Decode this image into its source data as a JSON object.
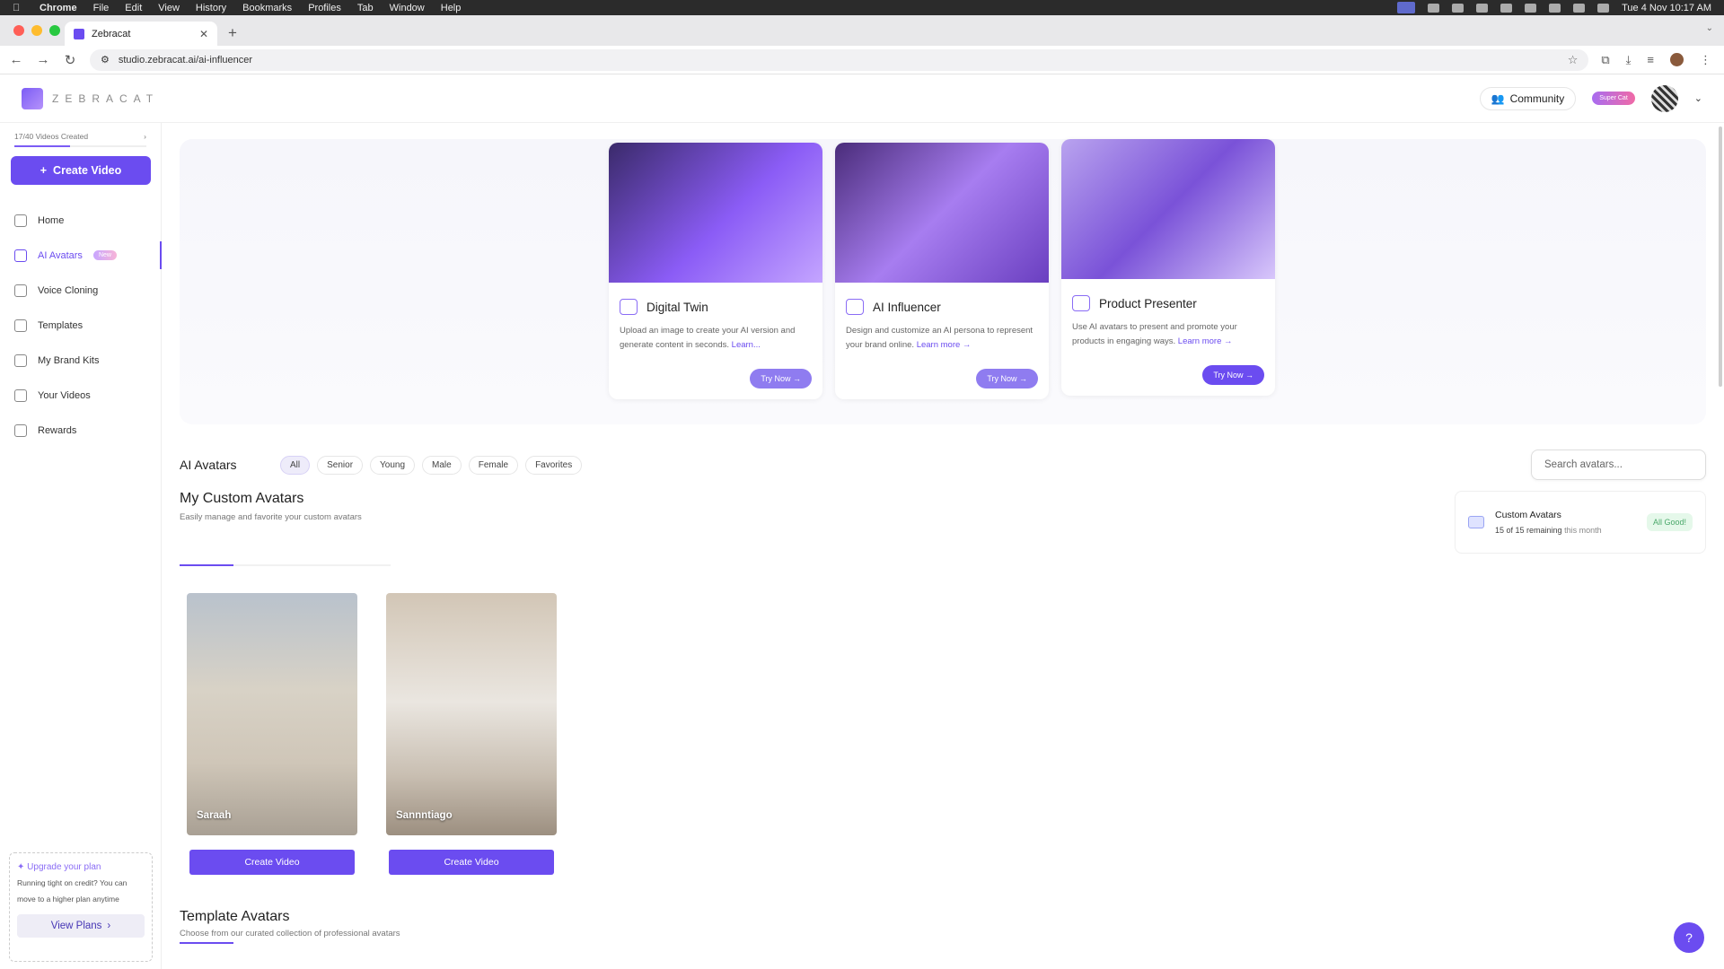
{
  "os_menu": {
    "app": "Chrome",
    "items": [
      "File",
      "Edit",
      "View",
      "History",
      "Bookmarks",
      "Profiles",
      "Tab",
      "Window",
      "Help"
    ],
    "clock": "Tue 4 Nov  10:17 AM"
  },
  "browser": {
    "tab_title": "Zebracat",
    "url": "studio.zebracat.ai/ai-influencer"
  },
  "header": {
    "logo_text": "ZEBRACAT",
    "community_label": "Community",
    "plan_label": "Super Cat"
  },
  "sidebar": {
    "usage_text": "17/40 Videos Created",
    "usage_fraction": 0.425,
    "create_label": "Create Video",
    "items": [
      {
        "label": "Home",
        "icon": "home-icon"
      },
      {
        "label": "AI Avatars",
        "icon": "sparkle-icon",
        "badge": "New"
      },
      {
        "label": "Voice Cloning",
        "icon": "waveform-icon"
      },
      {
        "label": "Templates",
        "icon": "template-icon"
      },
      {
        "label": "My Brand Kits",
        "icon": "brand-kit-icon"
      },
      {
        "label": "Your Videos",
        "icon": "video-icon"
      },
      {
        "label": "Rewards",
        "icon": "trophy-icon"
      }
    ],
    "upgrade": {
      "title": "Upgrade your plan",
      "text": "Running tight on credit? You can move to a higher plan anytime",
      "button": "View Plans"
    }
  },
  "features": [
    {
      "title": "Digital Twin",
      "desc": "Upload an image to create your AI version and generate content in seconds.",
      "learn": "Learn...",
      "button": "Try Now →"
    },
    {
      "title": "AI Influencer",
      "desc": "Design and customize an AI persona to represent your brand online.",
      "learn": "Learn more →",
      "button": "Try Now →"
    },
    {
      "title": "Product Presenter",
      "desc": "Use AI avatars to present and promote your products in engaging ways.",
      "learn": "Learn more →",
      "button": "Try Now →"
    }
  ],
  "filters": {
    "title": "AI Avatars",
    "chips": [
      "All",
      "Senior",
      "Young",
      "Male",
      "Female",
      "Favorites"
    ],
    "search_placeholder": "Search avatars..."
  },
  "custom": {
    "title": "My Custom Avatars",
    "subtitle": "Easily manage and favorite your custom avatars",
    "quota_title": "Custom Avatars",
    "quota_remaining": "15 of 15 remaining",
    "quota_period": "this month",
    "quota_status": "All Good!",
    "avatars": [
      {
        "name": "Saraah",
        "button": "Create Video"
      },
      {
        "name": "Sannntiago",
        "button": "Create Video"
      }
    ]
  },
  "templates": {
    "title": "Template Avatars",
    "subtitle": "Choose from our curated collection of professional avatars"
  }
}
